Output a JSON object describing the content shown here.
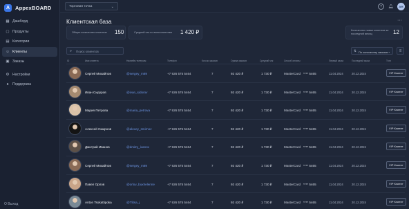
{
  "app": {
    "name": "AppexBOARD",
    "logo_letter": "A"
  },
  "topbar": {
    "point_select": "Торговая точка",
    "avatar_initials": "АМ"
  },
  "sidebar": {
    "items": [
      {
        "label": "Дашборд",
        "icon": "dashboard-icon",
        "glyph": "▦"
      },
      {
        "label": "Продукты",
        "icon": "box-icon",
        "glyph": "▢"
      },
      {
        "label": "Категории",
        "icon": "category-icon",
        "glyph": "▤"
      },
      {
        "label": "Клиенты",
        "icon": "users-icon",
        "glyph": "☺"
      },
      {
        "label": "Заказы",
        "icon": "cart-icon",
        "glyph": "▣"
      },
      {
        "label": "Настройки",
        "icon": "gear-icon",
        "glyph": "⚙"
      },
      {
        "label": "Поддержка",
        "icon": "support-icon",
        "glyph": "●"
      }
    ],
    "active_index": 3,
    "logout_label": "О Выход"
  },
  "page": {
    "title": "Клиентская база",
    "stats": [
      {
        "label": "Общее количество клиентов",
        "value": "150"
      },
      {
        "label": "Средний чек по всем клиентам",
        "value": "1 420 ₽"
      },
      {
        "label": "Количество новых клиентов за последний месяц",
        "value": "12"
      }
    ],
    "search_placeholder": "Поиск клиентов",
    "sort_label": "По количеству заказов"
  },
  "table": {
    "headers": [
      "ID",
      "Имя клиента",
      "Никнейм телеграм",
      "Телефон",
      "Кол-во заказов",
      "Сумма заказов",
      "Средний чек",
      "Способ оплаты",
      "Первый заказ",
      "Последний заказ",
      "Тэги"
    ],
    "rows": [
      {
        "name": "Сергей Михайлов",
        "username": "@sergey_m89",
        "phone": "+7 926 575 5464",
        "orders": "7",
        "total": "92 420 ₽",
        "avg": "1 730 ₽",
        "card": "MasterCard",
        "masked": "**** 5465",
        "first": "11.04.2024",
        "last": "20.12.2024",
        "tag": "VIP Клиент",
        "avatar": "#8a6a55"
      },
      {
        "name": "Иван Сидоров",
        "username": "@ivan_sidorov",
        "phone": "+7 926 575 5464",
        "orders": "7",
        "total": "92 420 ₽",
        "avg": "1 730 ₽",
        "card": "MasterCard",
        "masked": "**** 5465",
        "first": "11.04.2024",
        "last": "20.12.2024",
        "tag": "VIP Клиент",
        "avatar": "#a58a70"
      },
      {
        "name": "Мария Петрова",
        "username": "@maria_petrova",
        "phone": "+7 926 575 5464",
        "orders": "7",
        "total": "92 420 ₽",
        "avg": "1 730 ₽",
        "card": "MasterCard",
        "masked": "**** 5465",
        "first": "11.04.2024",
        "last": "20.12.2024",
        "tag": "VIP Клиент",
        "avatar": "#d9c2a8"
      },
      {
        "name": "Алексей Смирнов",
        "username": "@alexey_smirnov",
        "phone": "+7 926 575 5464",
        "orders": "7",
        "total": "92 420 ₽",
        "avg": "1 730 ₽",
        "card": "MasterCard",
        "masked": "**** 5465",
        "first": "11.04.2024",
        "last": "20.12.2024",
        "tag": "VIP Клиент",
        "avatar": "#141414"
      },
      {
        "name": "Дмитрий Иванов",
        "username": "@dmitry_ivanov",
        "phone": "+7 926 575 5464",
        "orders": "7",
        "total": "92 420 ₽",
        "avg": "1 730 ₽",
        "card": "MasterCard",
        "masked": "**** 5465",
        "first": "11.04.2024",
        "last": "20.12.2024",
        "tag": "VIP Клиент",
        "avatar": "#5d5148"
      },
      {
        "name": "Сергей Михайлов",
        "username": "@sergey_m89",
        "phone": "+7 926 575 5464",
        "orders": "7",
        "total": "92 420 ₽",
        "avg": "1 730 ₽",
        "card": "MasterCard",
        "masked": "**** 5465",
        "first": "11.04.2024",
        "last": "20.12.2024",
        "tag": "VIP Клиент",
        "avatar": "#8a6a55"
      },
      {
        "name": "Павел Орлов",
        "username": "@orlov_buxhelenne",
        "phone": "+7 926 575 5464",
        "orders": "7",
        "total": "92 420 ₽",
        "avg": "1 730 ₽",
        "card": "MasterCard",
        "masked": "**** 5465",
        "first": "11.04.2024",
        "last": "20.12.2024",
        "tag": "VIP Клиент",
        "avatar": "#c9a488"
      },
      {
        "name": "Anton Tsokattipoka",
        "username": "@Tlitsa_j",
        "phone": "+7 926 575 5464",
        "orders": "7",
        "total": "92 420 ₽",
        "avg": "1 730 ₽",
        "card": "MasterCard",
        "masked": "**** 5465",
        "first": "11.04.2024",
        "last": "20.12.2024",
        "tag": "VIP Клиент",
        "avatar": "#7a8a96"
      }
    ]
  }
}
